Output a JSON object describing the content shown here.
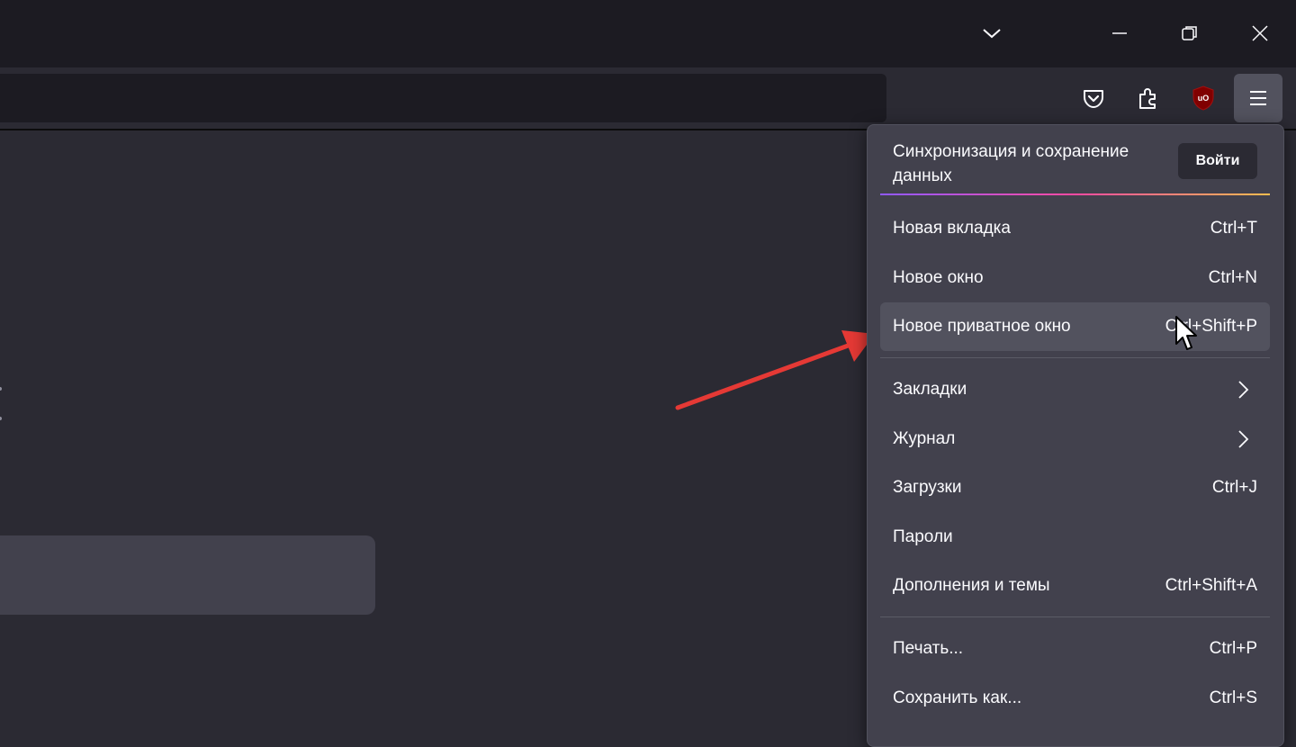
{
  "window_controls": {
    "list_all_tabs_icon": "chevron-down-icon",
    "minimize_icon": "minimize-icon",
    "restore_icon": "restore-icon",
    "close_icon": "close-icon"
  },
  "toolbar": {
    "pocket_icon": "pocket-icon",
    "extensions_icon": "puzzle-icon",
    "ublock_icon": "ublock-origin-icon",
    "ublock_label": "uO",
    "menu_icon": "hamburger-menu-icon"
  },
  "app_menu": {
    "sync": {
      "text": "Синхронизация и сохранение данных",
      "signin_label": "Войти"
    },
    "items": [
      {
        "label": "Новая вкладка",
        "shortcut": "Ctrl+T"
      },
      {
        "label": "Новое окно",
        "shortcut": "Ctrl+N"
      },
      {
        "label": "Новое приватное окно",
        "shortcut": "Ctrl+Shift+P"
      },
      {
        "label": "Закладки",
        "shortcut": ""
      },
      {
        "label": "Журнал",
        "shortcut": ""
      },
      {
        "label": "Загрузки",
        "shortcut": "Ctrl+J"
      },
      {
        "label": "Пароли",
        "shortcut": ""
      },
      {
        "label": "Дополнения и темы",
        "shortcut": "Ctrl+Shift+A"
      },
      {
        "label": "Печать...",
        "shortcut": "Ctrl+P"
      },
      {
        "label": "Сохранить как...",
        "shortcut": "Ctrl+S"
      }
    ]
  },
  "colors": {
    "titlebar": "#1c1b22",
    "toolbar": "#2b2a33",
    "menu_background": "#42414d",
    "hover": "#52525e",
    "annotation_arrow": "#e53935",
    "ublock_red": "#800000"
  }
}
